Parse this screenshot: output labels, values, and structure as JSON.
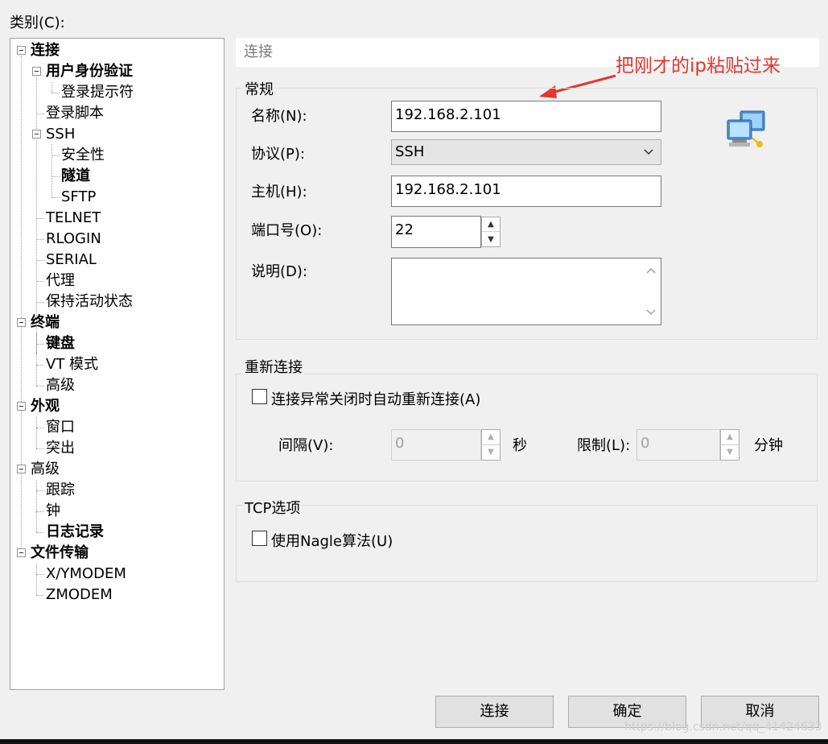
{
  "category_label": "类别(C):",
  "tree": {
    "items": [
      {
        "label": "连接"
      },
      {
        "label": "用户身份验证"
      },
      {
        "label": "登录提示符"
      },
      {
        "label": "登录脚本"
      },
      {
        "label": "SSH"
      },
      {
        "label": "安全性"
      },
      {
        "label": "隧道"
      },
      {
        "label": "SFTP"
      },
      {
        "label": "TELNET"
      },
      {
        "label": "RLOGIN"
      },
      {
        "label": "SERIAL"
      },
      {
        "label": "代理"
      },
      {
        "label": "保持活动状态"
      },
      {
        "label": "终端"
      },
      {
        "label": "键盘"
      },
      {
        "label": "VT 模式"
      },
      {
        "label": "高级"
      },
      {
        "label": "外观"
      },
      {
        "label": "窗口"
      },
      {
        "label": "突出"
      },
      {
        "label": "高级"
      },
      {
        "label": "跟踪"
      },
      {
        "label": "钟"
      },
      {
        "label": "日志记录"
      },
      {
        "label": "文件传输"
      },
      {
        "label": "X/YMODEM"
      },
      {
        "label": "ZMODEM"
      }
    ]
  },
  "header": {
    "title": "连接"
  },
  "annotation": {
    "text": "把刚才的ip粘贴过来",
    "color": "#e4352e"
  },
  "general": {
    "title": "常规",
    "name_label": "名称(N):",
    "name_value": "192.168.2.101",
    "protocol_label": "协议(P):",
    "protocol_value": "SSH",
    "host_label": "主机(H):",
    "host_value": "192.168.2.101",
    "port_label": "端口号(O):",
    "port_value": "22",
    "desc_label": "说明(D):",
    "desc_value": ""
  },
  "reconnect": {
    "title": "重新连接",
    "auto_label": "连接异常关闭时自动重新连接(A)",
    "interval_label": "间隔(V):",
    "interval_value": "0",
    "interval_unit": "秒",
    "limit_label": "限制(L):",
    "limit_value": "0",
    "limit_unit": "分钟"
  },
  "tcp": {
    "title": "TCP选项",
    "nagle_label": "使用Nagle算法(U)"
  },
  "buttons": {
    "connect": "连接",
    "ok": "确定",
    "cancel": "取消"
  },
  "watermark": "https://blog.csdn.net/qq_41424633"
}
